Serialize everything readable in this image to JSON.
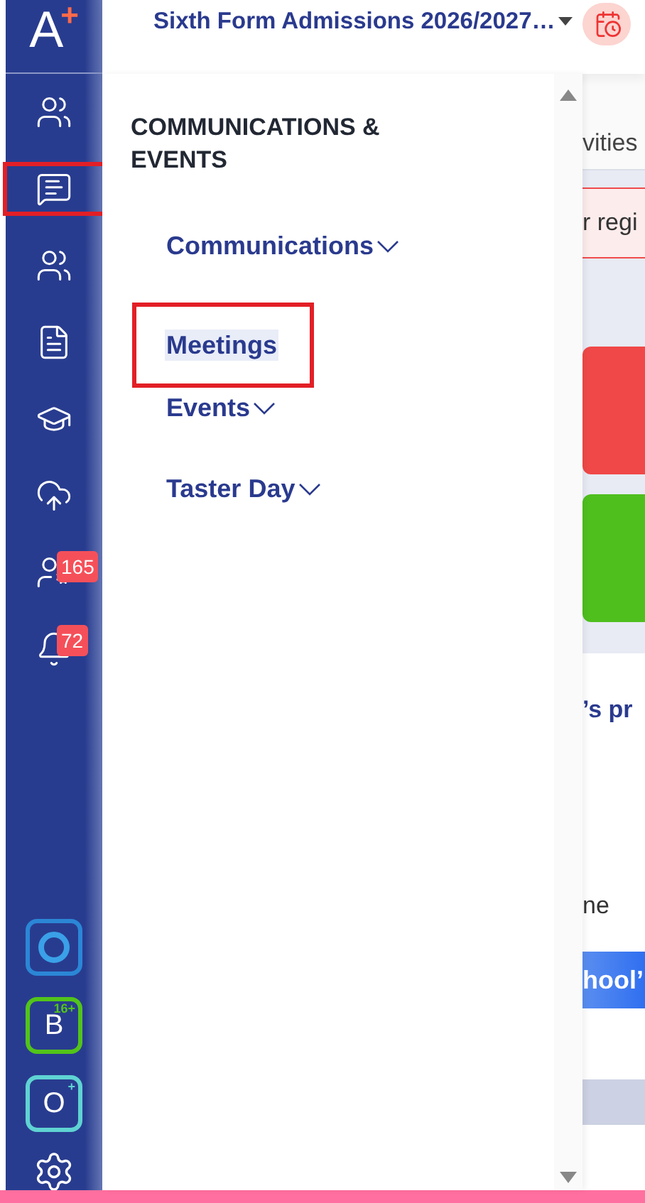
{
  "sidebar": {
    "logo": "A",
    "logo_mark": "+",
    "items": [
      {
        "selected": false
      },
      {
        "selected": true
      },
      {
        "selected": false
      },
      {
        "selected": false
      },
      {
        "selected": false
      },
      {
        "selected": false
      },
      {
        "selected": false,
        "badge": "165"
      },
      {
        "selected": false,
        "badge": "72"
      }
    ],
    "apps": [
      {
        "kind": "ring",
        "color": "#2b86d6"
      },
      {
        "kind": "letter",
        "letter": "B",
        "mark": "16+",
        "color": "#52c41a"
      },
      {
        "kind": "letter",
        "letter": "O",
        "mark": "+",
        "color": "#5fd3d3"
      }
    ]
  },
  "header": {
    "title": "Sixth Form Admissions 2026/2027…"
  },
  "menu": {
    "heading": "COMMUNICATIONS & EVENTS",
    "items": [
      {
        "label": "Communications",
        "kind": "group",
        "selected": false
      },
      {
        "label": "Meetings",
        "kind": "link",
        "selected": true
      },
      {
        "label": "Events",
        "kind": "group",
        "selected": false
      },
      {
        "label": "Taster Day",
        "kind": "group",
        "selected": false
      }
    ]
  },
  "background": {
    "tab_fragment": "vities",
    "alert_fragment": "r regi",
    "tiles": [
      {
        "color": "#f04848"
      },
      {
        "color": "#4fbf1e"
      }
    ],
    "heading_fragment": "’s pr",
    "text_fragment": "ne",
    "button_fragment": "hool’"
  }
}
